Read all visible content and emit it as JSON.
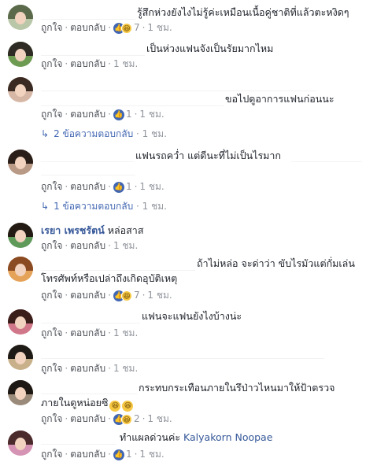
{
  "ui": {
    "like": "ถูกใจ",
    "reply": "ตอบกลับ",
    "dot": "·"
  },
  "comments": [
    {
      "text": "รู้สึกห่วงยังไงไม่รู้ค่ะเหมือนเนื้อคู่ชาติที่แล้วตะหงิดๆ",
      "reactions": "7",
      "time": "1 ชม."
    },
    {
      "text": "เป็นห่วงแฟนจังเป็นรัยมากไหม",
      "reactions": "",
      "time": "1 ชม."
    },
    {
      "text": "ขอไปดูอาการแฟนก่อนนะ",
      "reactions": "1",
      "time": "1 ชม.",
      "replies": "2 ข้อความตอบกลับ",
      "replies_time": "1 ชม."
    },
    {
      "text": "แฟนรถคว่ำ แต่ดีนะที่ไม่เป็นไรมาก",
      "reactions": "1",
      "time": "1 ชม.",
      "replies": "1 ข้อความตอบกลับ",
      "replies_time": "1 ชม."
    },
    {
      "name": "เรยา เพรชรัตน์",
      "text": "หล่อสาส",
      "reactions": "",
      "time": "1 ชม."
    },
    {
      "text": "ถ้าไม่หล่อ จะด่าว่า ขับไรมัวแต่กั่มเล่น",
      "text2": "โทรศัพท์หรือเปล่าถึงเกิดอุบัติเหตุ",
      "reactions": "7",
      "time": "1 ชม."
    },
    {
      "text": "แฟนจะแฟนยังไงบ้างน่ะ",
      "reactions": "",
      "time": "1 ชม."
    },
    {
      "text": "",
      "reactions": "",
      "time": "1 ชม."
    },
    {
      "text": "กระทบกระเทือนภายในรึป่าวไหนมาให้ป้าตรวจ",
      "text2": "ภายในดูหน่อยซิ",
      "reactions": "2",
      "time": "1 ชม."
    },
    {
      "text": "ทำแผลด่วนค่ะ",
      "tag": "Kalyakorn Noopae",
      "reactions": "1",
      "time": "1 ชม."
    }
  ]
}
